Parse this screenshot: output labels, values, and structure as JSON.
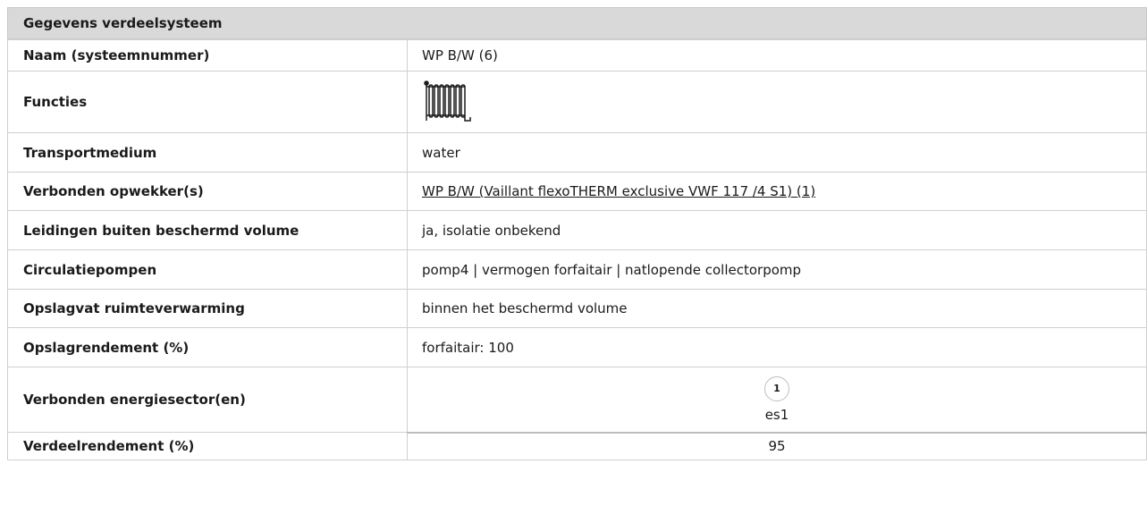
{
  "section": {
    "title": "Gegevens verdeelsysteem"
  },
  "rows": [
    {
      "label": "Naam (systeemnummer)",
      "value": "WP B/W (6)"
    },
    {
      "label": "Functies",
      "icon": "radiator-icon"
    },
    {
      "label": "Transportmedium",
      "value": "water"
    },
    {
      "label": "Verbonden opwekker(s)",
      "value": "WP B/W (Vaillant flexoTHERM exclusive VWF 117 /4 S1) (1)"
    },
    {
      "label": "Leidingen buiten beschermd volume",
      "value": "ja, isolatie onbekend"
    },
    {
      "label": "Circulatiepompen",
      "value": "pomp4 | vermogen forfaitair | natlopende collectorpomp"
    },
    {
      "label": "Opslagvat ruimteverwarming",
      "value": "binnen het beschermd volume"
    },
    {
      "label": "Opslagrendement (%)",
      "value": "forfaitair: 100"
    },
    {
      "label": "Verbonden energiesector(en)",
      "badge": "1",
      "value": "es1"
    },
    {
      "label": "Verdeelrendement (%)",
      "value": "95"
    }
  ]
}
